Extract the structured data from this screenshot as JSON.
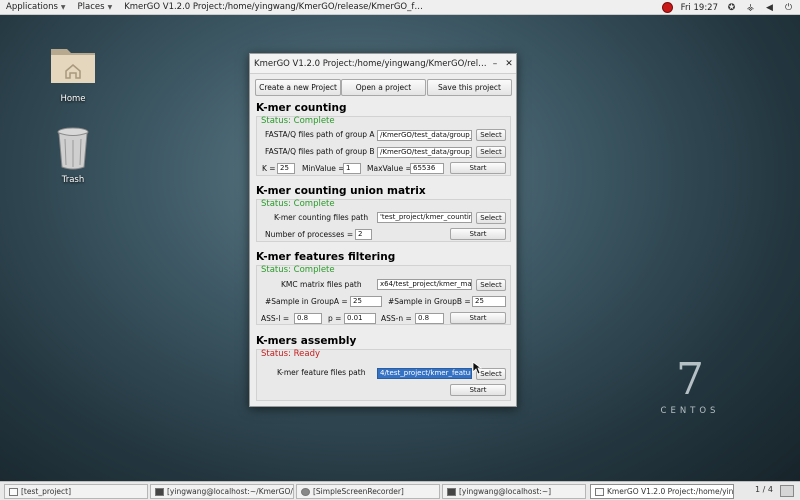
{
  "topbar": {
    "applications": "Applications",
    "places": "Places",
    "window_title": "KmerGO V1.2.0 Project:/home/yingwang/KmerGO/release/KmerGO_for_linux_...",
    "clock": "Fri 19:27"
  },
  "desktop": {
    "home_label": "Home",
    "trash_label": "Trash",
    "brand_number": "7",
    "brand_word": "CENTOS"
  },
  "window": {
    "title": "KmerGO V1.2.0 Project:/home/yingwang/KmerGO/release/...",
    "buttons": {
      "create": "Create a new Project",
      "open": "Open a project",
      "save": "Save this project"
    },
    "counting": {
      "title": "K-mer counting",
      "status": "Status: Complete",
      "group_a_label": "FASTA/Q files path of group A",
      "group_a_value": "/KmerGO/test_data/group_A",
      "group_b_label": "FASTA/Q files path of group B",
      "group_b_value": "/KmerGO/test_data/group_B",
      "k_label": "K =",
      "k_value": "25",
      "min_label": "MinValue =",
      "min_value": "1",
      "max_label": "MaxValue =",
      "max_value": "65536",
      "select": "Select",
      "start": "Start"
    },
    "union": {
      "title": "K-mer counting union matrix",
      "status": "Status: Complete",
      "path_label": "K-mer counting files path",
      "path_value": "'test_project/kmer_countings",
      "proc_label": "Number of processes =",
      "proc_value": "2",
      "select": "Select",
      "start": "Start"
    },
    "filtering": {
      "title": "K-mer features filtering",
      "status": "Status: Complete",
      "path_label": "KMC matrix files path",
      "path_value": "x64/test_project/kmer_matrix",
      "sa_label": "#Sample in GroupA =",
      "sa_value": "25",
      "sb_label": "#Sample in GroupB =",
      "sb_value": "25",
      "assl_label": "ASS-l =",
      "assl_value": "0.8",
      "p_label": "p =",
      "p_value": "0.01",
      "assn_label": "ASS-n =",
      "assn_value": "0.8",
      "select": "Select",
      "start": "Start"
    },
    "assembly": {
      "title": "K-mers assembly",
      "status": "Status: Ready",
      "path_label": "K-mer feature files path",
      "path_value": "4/test_project/kmer_features",
      "select": "Select",
      "start": "Start"
    }
  },
  "taskbar": {
    "tasks": [
      "[test_project]",
      "[yingwang@localhost:~/KmerGO/rel...",
      "[SimpleScreenRecorder]",
      "[yingwang@localhost:~]",
      "KmerGO V1.2.0 Project:/home/ying..."
    ],
    "pager": "1 / 4"
  },
  "colors": {
    "status_complete": "#2a9a2a",
    "status_ready": "#c41e1e",
    "selection": "#3572c4"
  }
}
